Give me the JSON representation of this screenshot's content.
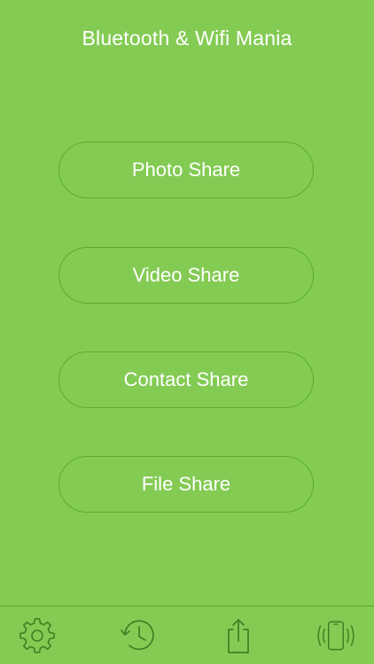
{
  "header": {
    "title": "Bluetooth & Wifi Mania"
  },
  "menu": {
    "items": [
      {
        "label": "Photo Share"
      },
      {
        "label": "Video Share"
      },
      {
        "label": "Contact Share"
      },
      {
        "label": "File Share"
      }
    ]
  },
  "tabbar": {
    "icons": [
      "gear-icon",
      "history-icon",
      "share-icon",
      "vibrate-phone-icon"
    ]
  },
  "colors": {
    "background": "#84cb54",
    "outline": "#5aac2e",
    "text": "#ffffff"
  }
}
